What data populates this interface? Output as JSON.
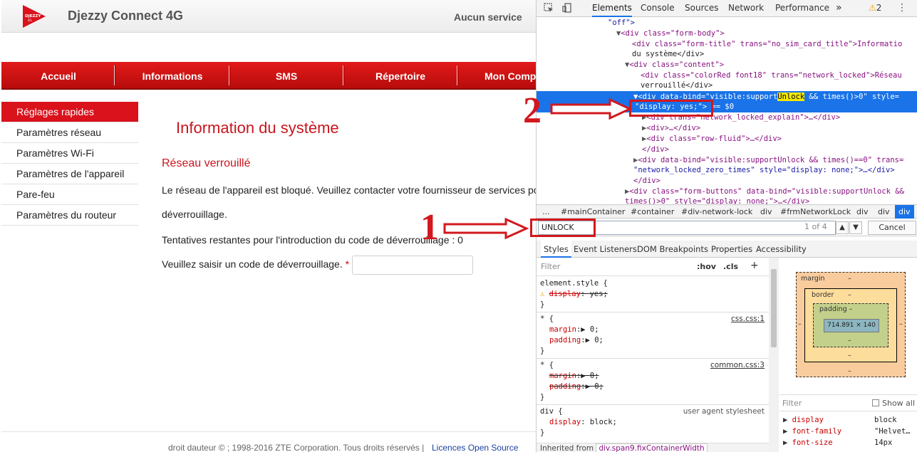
{
  "app": {
    "title": "Djezzy Connect 4G",
    "logo_text": "DJEZZY",
    "logo_sub": "4G",
    "service_status": "Aucun service",
    "brand_color": "#d9121c"
  },
  "nav": {
    "items": [
      "Accueil",
      "Informations",
      "SMS",
      "Répertoire",
      "Mon Comp"
    ]
  },
  "sidebar": {
    "items": [
      "Réglages rapides",
      "Paramètres réseau",
      "Paramètres Wi-Fi",
      "Paramètres de l'appareil",
      "Pare-feu",
      "Paramètres du routeur"
    ],
    "active_index": 0
  },
  "content": {
    "title": "Information du système",
    "subtitle": "Réseau verrouillé",
    "message_line1": "Le réseau de l'appareil est bloqué. Veuillez contacter votre fournisseur de services po",
    "message_line2": "déverrouillage.",
    "attempts": "Tentatives restantes pour l'introduction du code de déverrouillage : 0",
    "code_label": "Veuillez saisir un code de déverrouillage.",
    "required_mark": "*",
    "code_value": ""
  },
  "footer": {
    "copyright": "droit dauteur © ; 1998-2016 ZTE Corporation. Tous droits réservés  |",
    "link": "Licences Open Source"
  },
  "devtools": {
    "tabs": [
      "Elements",
      "Console",
      "Sources",
      "Network",
      "Performance",
      "»"
    ],
    "active_tab": "Elements",
    "warnings_count": "2",
    "more_icon": "kebab-icon",
    "dom_lines": [
      "\"off\">",
      "div class=\"form-body\"",
      "div class=\"form-title\" trans=\"no_sim_card_title\">Informatio",
      "du système</div>",
      "div class=\"content\"",
      "div class=\"colorRed font18\" trans=\"network_locked\">Réseau",
      "verrouillé</div>",
      "div data-bind=\"visible:supportUnlock && times()>0\" style=",
      "\"display: yes;\"> == $0",
      "div trans=\"network_locked_explain\">…</div>",
      "div>…</div>",
      "div class=\"row-fluid\">…</div>",
      "</div>",
      "div data-bind=\"visible:supportUnlock && times()==0\" trans=",
      "\"network_locked_zero_times\" style=\"display: none;\">…</div>",
      "</div>",
      "div class=\"form-buttons\" data-bind=\"visible:supportUnlock &&",
      "times()>0\" style=\"display: none;\">…</div>"
    ],
    "highlight_word": "Unlock",
    "breadcrumbs": [
      "...",
      "#mainContainer",
      "#container",
      "#div-network-lock",
      "div",
      "#frmNetworkLock",
      "div",
      "div",
      "div"
    ],
    "search": {
      "value": "UNLOCK",
      "count": "1 of 4",
      "cancel": "Cancel"
    },
    "subtabs": [
      "Styles",
      "Event Listeners",
      "DOM Breakpoints",
      "Properties",
      "Accessibility"
    ],
    "styles": {
      "filter_placeholder": "Filter",
      "hov": ":hov",
      "cls": ".cls",
      "plus": "+",
      "rules": [
        {
          "selector": "element.style {",
          "decls": [
            {
              "name": "display",
              "value": "yes;",
              "struck": true,
              "warn": true
            }
          ],
          "source": ""
        },
        {
          "selector": "* {",
          "decls": [
            {
              "name": "margin",
              "value": "0;"
            },
            {
              "name": "padding",
              "value": "0;"
            }
          ],
          "source": "css.css:1"
        },
        {
          "selector": "* {",
          "decls": [
            {
              "name": "margin",
              "value": "0;",
              "struck": true
            },
            {
              "name": "padding",
              "value": "0;",
              "struck": true
            }
          ],
          "source": "common.css:3"
        },
        {
          "selector": "div {",
          "decls": [
            {
              "name": "display",
              "value": "block;"
            }
          ],
          "source": "user agent stylesheet"
        }
      ],
      "inherited_label": "Inherited from",
      "inherited_class": "div.span9.fixContainerWidth"
    },
    "boxmodel": {
      "margin_label": "margin",
      "border_label": "border",
      "padding_label": "padding",
      "dash": "–",
      "content_size": "714.891 × 140"
    },
    "computed": {
      "filter_placeholder": "Filter",
      "show_all": "Show all",
      "props": [
        {
          "name": "display",
          "value": "block"
        },
        {
          "name": "font-family",
          "value": "\"Helvet…"
        },
        {
          "name": "font-size",
          "value": "14px"
        }
      ]
    }
  },
  "annotations": {
    "label1": "1",
    "label2": "2",
    "color": "#d2181e"
  }
}
